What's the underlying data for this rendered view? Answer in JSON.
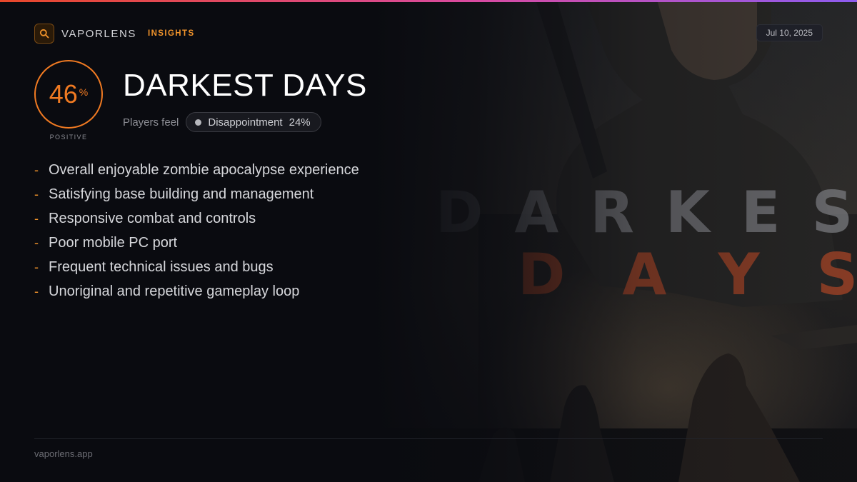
{
  "brand": {
    "name": "VAPORLENS",
    "tag": "INSIGHTS",
    "icon": "search-icon",
    "accent_color": "#f0932b"
  },
  "date": "Jul 10, 2025",
  "score": {
    "value": "46",
    "unit": "%",
    "caption": "POSITIVE",
    "color": "#f07a22"
  },
  "game": {
    "title": "DARKEST DAYS",
    "feel_label": "Players feel",
    "emotion": {
      "name": "Disappointment",
      "percent": "24%"
    }
  },
  "points": [
    "Overall enjoyable zombie apocalypse experience",
    "Satisfying base building and management",
    "Responsive combat and controls",
    "Poor mobile PC port",
    "Frequent technical issues and bugs",
    "Unoriginal and repetitive gameplay loop"
  ],
  "hero_art": {
    "line1": "DARKEST",
    "line2": "DAYS"
  },
  "footer": {
    "url": "vaporlens.app"
  }
}
